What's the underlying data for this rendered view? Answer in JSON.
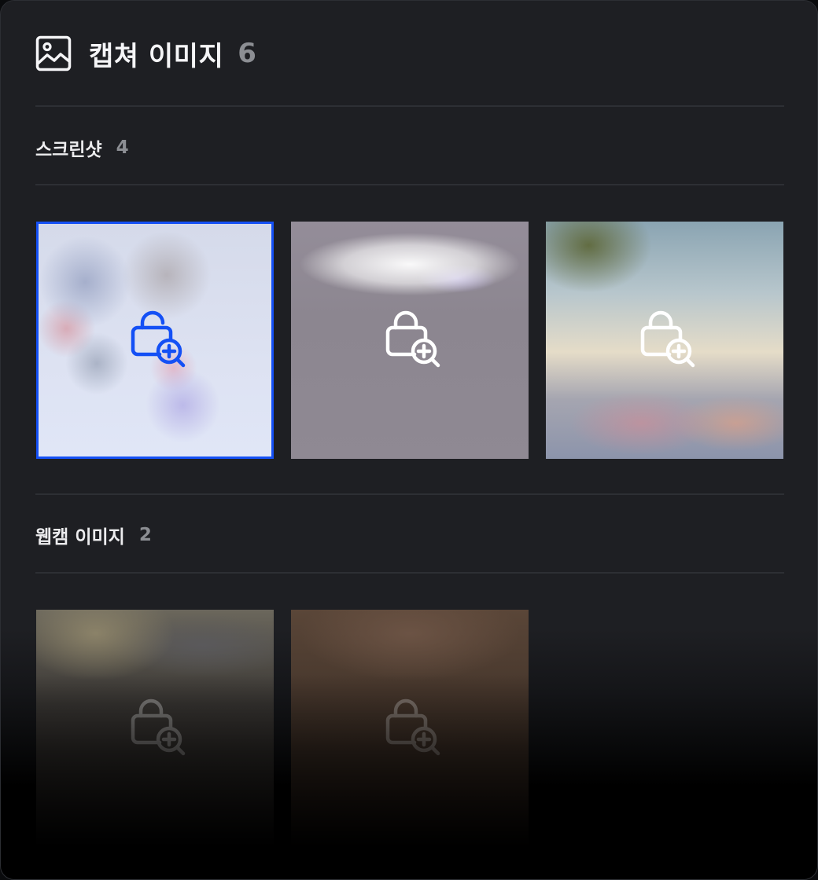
{
  "header": {
    "title": "캡쳐 이미지",
    "count": "6",
    "icon": "image-icon"
  },
  "sections": [
    {
      "label": "스크린샷",
      "count": "4",
      "items": [
        {
          "icon": "lock-zoom-icon",
          "selected": true
        },
        {
          "icon": "lock-zoom-icon",
          "selected": false
        },
        {
          "icon": "lock-zoom-icon",
          "selected": false
        }
      ]
    },
    {
      "label": "웹캠 이미지",
      "count": "2",
      "items": [
        {
          "icon": "lock-zoom-icon",
          "selected": false
        },
        {
          "icon": "lock-zoom-icon",
          "selected": false
        }
      ]
    }
  ],
  "colors": {
    "accent": "#1450f5",
    "background": "#1e1f23",
    "muted": "#8c8e93"
  }
}
